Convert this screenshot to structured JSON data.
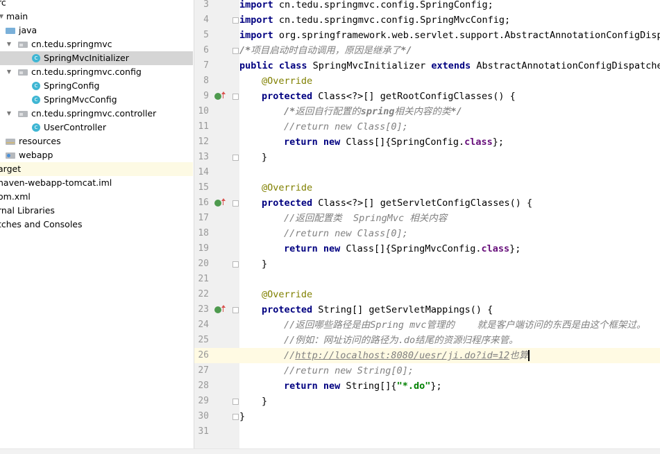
{
  "project_tree": {
    "rows": [
      {
        "label": "rc"
      },
      {
        "label": "main"
      },
      {
        "label": "java"
      },
      {
        "label": "cn.tedu.springmvc"
      },
      {
        "label": "SpringMvcInitializer"
      },
      {
        "label": "cn.tedu.springmvc.config"
      },
      {
        "label": "SpringConfig"
      },
      {
        "label": "SpringMvcConfig"
      },
      {
        "label": "cn.tedu.springmvc.controller"
      },
      {
        "label": "UserController"
      },
      {
        "label": "resources"
      },
      {
        "label": "webapp"
      },
      {
        "label": "arget"
      },
      {
        "label": "naven-webapp-tomcat.iml"
      },
      {
        "label": "om.xml"
      },
      {
        "label": "rnal Libraries"
      },
      {
        "label": "tches and Consoles"
      }
    ],
    "icons": [
      "folder-icon",
      "source-folder-icon",
      "package-icon",
      "class-icon",
      "resources-folder-icon",
      "web-folder-icon",
      "module-file-icon",
      "xml-file-icon",
      "libraries-icon",
      "scratches-icon"
    ],
    "class_badge": "c",
    "selected_file": "SpringMvcInitializer",
    "highlighted_item": "arget"
  },
  "gutter": {
    "line_numbers": [
      "3",
      "4",
      "5",
      "6",
      "7",
      "8",
      "9",
      "10",
      "11",
      "12",
      "13",
      "14",
      "15",
      "16",
      "17",
      "18",
      "19",
      "20",
      "21",
      "22",
      "23",
      "24",
      "25",
      "26",
      "27",
      "28",
      "29",
      "30",
      "31"
    ],
    "override_marker_lines": [
      "9",
      "16",
      "23"
    ],
    "current_line": "26"
  },
  "code": {
    "lines": [
      {
        "t": [
          "import",
          " cn.tedu.springmvc.config.SpringConfig;"
        ]
      },
      {
        "t": [
          "import",
          " cn.tedu.springmvc.config.SpringMvcConfig;"
        ]
      },
      {
        "t": [
          "import",
          " org.springframework.web.servlet.support.AbstractAnnotationConfigDispa"
        ]
      },
      {
        "t": [
          "/*",
          "项目启动时自动调用，原因是继承了",
          "*/"
        ]
      },
      {
        "t": [
          "public class",
          " SpringMvcInitializer ",
          "extends",
          " AbstractAnnotationConfigDispatcher"
        ]
      },
      {
        "t": [
          "@Override"
        ]
      },
      {
        "t": [
          "protected",
          " Class<?>[] getRootConfigClasses() {"
        ]
      },
      {
        "t": [
          "/*",
          "返回自行配置的",
          "spring",
          "相关内容的类",
          "*/"
        ]
      },
      {
        "t": [
          "//return new Class[0];"
        ]
      },
      {
        "t": [
          "return new",
          " Class[]{SpringConfig.",
          "class",
          "};"
        ]
      },
      {
        "t": [
          "}"
        ]
      },
      {
        "t": [
          ""
        ]
      },
      {
        "t": [
          "@Override"
        ]
      },
      {
        "t": [
          "protected",
          " Class<?>[] getServletConfigClasses() {"
        ]
      },
      {
        "t": [
          "//返回配置类  SpringMvc 相关内容"
        ]
      },
      {
        "t": [
          "//return new Class[0];"
        ]
      },
      {
        "t": [
          "return new",
          " Class[]{SpringMvcConfig.",
          "class",
          "};"
        ]
      },
      {
        "t": [
          "}"
        ]
      },
      {
        "t": [
          ""
        ]
      },
      {
        "t": [
          "@Override"
        ]
      },
      {
        "t": [
          "protected",
          " String[] getServletMappings() {"
        ]
      },
      {
        "t": [
          "//返回哪些路径是由Spring mvc管理的    就是客户端访问的东西是由这个框架过。"
        ]
      },
      {
        "t": [
          "//例如：网址访问的路径为.do结尾的资源归程序来管。"
        ]
      },
      {
        "t": [
          "//",
          "http://localhost:8080/uesr/ji.do?id=12",
          "也算"
        ]
      },
      {
        "t": [
          "//return new String[0];"
        ]
      },
      {
        "t": [
          "return new",
          " String[]{",
          "\"*.do\"",
          "};"
        ]
      },
      {
        "t": [
          "}"
        ]
      },
      {
        "t": [
          "}"
        ]
      },
      {
        "t": [
          ""
        ]
      }
    ]
  },
  "colors": {
    "keyword": "#000080",
    "annotation": "#808000",
    "comment": "#808080",
    "string": "#008000",
    "field": "#660e7a",
    "selection": "#d5d5d5",
    "current_line": "#fffae3",
    "class_icon": "#3fb6d3",
    "override_marker": "#4e9a4e"
  }
}
